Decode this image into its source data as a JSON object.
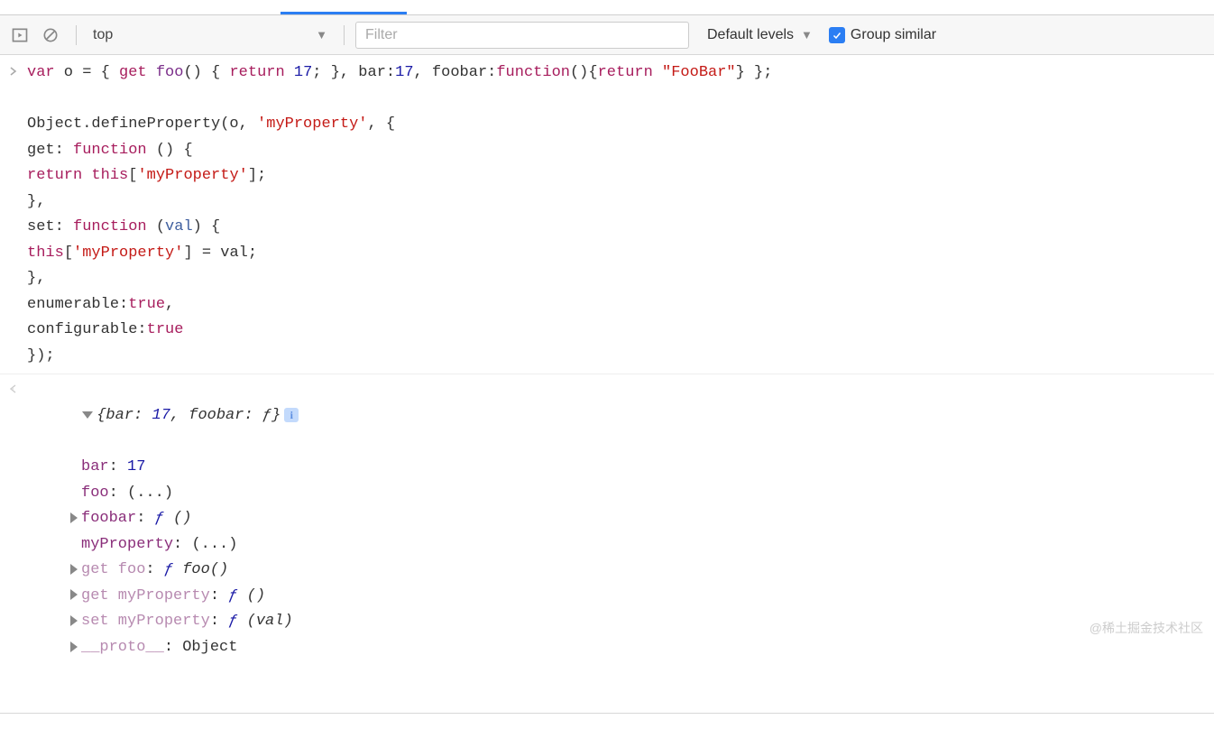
{
  "toolbar": {
    "context": "top",
    "filter_placeholder": "Filter",
    "levels_label": "Default levels",
    "group_similar_label": "Group similar"
  },
  "input_code": {
    "line1": {
      "t1": "var",
      "t2": " o = { ",
      "t3": "get",
      "t4": " ",
      "t5": "foo",
      "t6": "() { ",
      "t7": "return",
      "t8": " ",
      "t9": "17",
      "t10": "; }, bar:",
      "t11": "17",
      "t12": ", foobar:",
      "t13": "function",
      "t14": "(){",
      "t15": "return",
      "t16": " ",
      "t17": "\"FooBar\"",
      "t18": "} };"
    },
    "blank1": "",
    "line2": {
      "t1": "Object.defineProperty(o, ",
      "t2": "'myProperty'",
      "t3": ", {"
    },
    "line3": {
      "t1": "get: ",
      "t2": "function",
      "t3": " () {"
    },
    "line4": {
      "t1": "return",
      "t2": " ",
      "t3": "this",
      "t4": "[",
      "t5": "'myProperty'",
      "t6": "];"
    },
    "line5": "},",
    "line6": {
      "t1": "set: ",
      "t2": "function",
      "t3": " (",
      "t4": "val",
      "t5": ") {"
    },
    "line7": {
      "t1": "this",
      "t2": "[",
      "t3": "'myProperty'",
      "t4": "] = val;"
    },
    "line8": "},",
    "line9": {
      "t1": "enumerable:",
      "t2": "true",
      "t3": ","
    },
    "line10": {
      "t1": "configurable:",
      "t2": "true"
    },
    "line11": "});"
  },
  "result": {
    "summary": {
      "t1": "{bar: ",
      "t2": "17",
      "t3": ", foobar: ",
      "t4": "ƒ",
      "t5": "}"
    },
    "props": [
      {
        "k": "bar",
        "v": "17",
        "vtype": "num",
        "arrow": false,
        "faded": false
      },
      {
        "k": "foo",
        "v": "(...)",
        "vtype": "txt",
        "arrow": false,
        "faded": false
      },
      {
        "k": "foobar",
        "v": "ƒ ()",
        "vtype": "fn",
        "arrow": true,
        "faded": false
      },
      {
        "k": "myProperty",
        "v": "(...)",
        "vtype": "txt",
        "arrow": false,
        "faded": false
      },
      {
        "k": "get foo",
        "v": "ƒ foo()",
        "vtype": "fn",
        "arrow": true,
        "faded": true
      },
      {
        "k": "get myProperty",
        "v": "ƒ ()",
        "vtype": "fn",
        "arrow": true,
        "faded": true
      },
      {
        "k": "set myProperty",
        "v": "ƒ (val)",
        "vtype": "fn",
        "arrow": true,
        "faded": true
      },
      {
        "k": "__proto__",
        "v": "Object",
        "vtype": "txt",
        "arrow": true,
        "faded": true
      }
    ]
  },
  "watermark": "@稀土掘金技术社区"
}
